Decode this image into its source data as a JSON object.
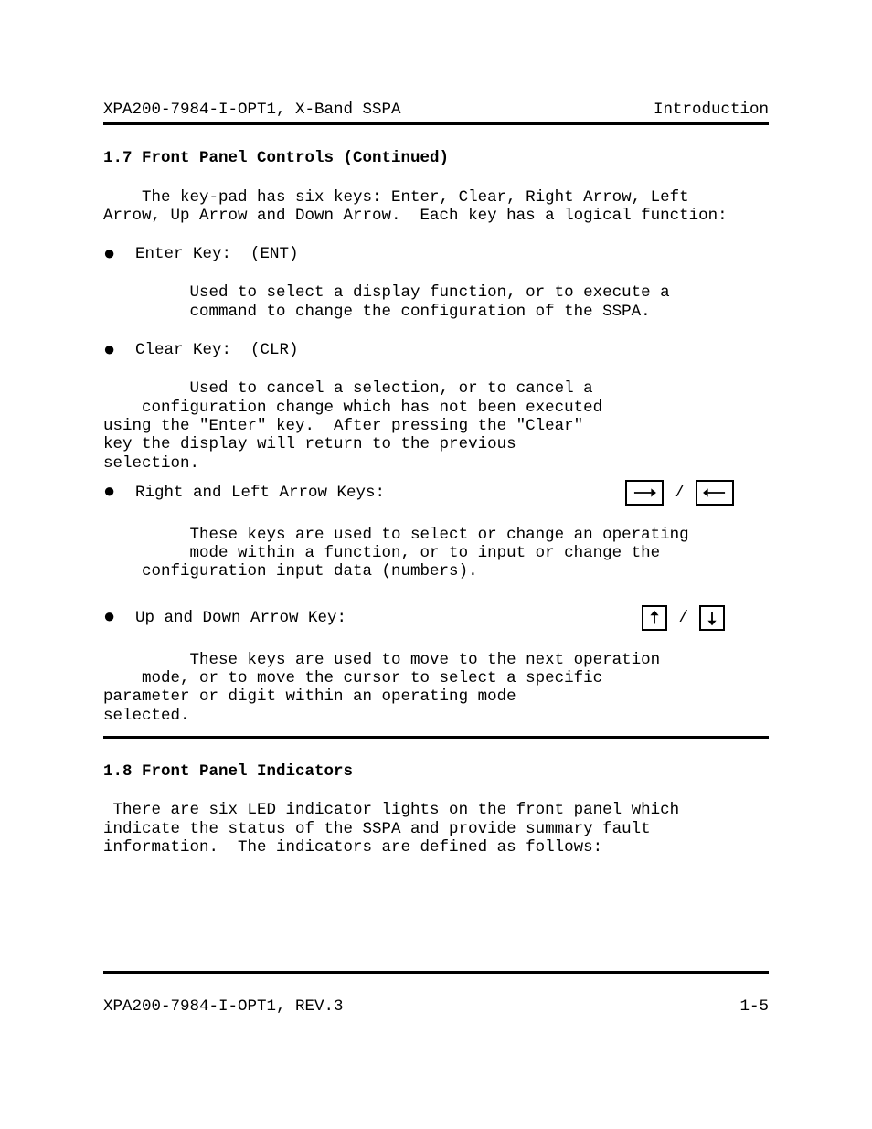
{
  "header_left": "XPA200-7984-I-OPT1, X-Band SSPA",
  "header_right": "Introduction",
  "section1": {
    "heading": "1.7 Front Panel Controls (Continued)",
    "intro_l1": "    The key-pad has six keys: Enter, Clear, Right Arrow, Left",
    "intro_l2": "Arrow, Up Arrow and Down Arrow.  Each key has a logical function:",
    "b1_label": "  Enter Key:  (ENT)",
    "b1_desc_l1": "         Used to select a display function, or to execute a",
    "b1_desc_l2": "         command to change the configuration of the SSPA.",
    "b2_label": "  Clear Key:  (CLR)",
    "b2_desc_l1": "         Used to cancel a selection, or to cancel a",
    "b2_desc_l2": "    configuration change which has not been executed",
    "b2_desc_l3": "using the \"Enter\" key.  After pressing the \"Clear\"",
    "b2_desc_l4": "key the display will return to the previous",
    "b2_desc_l5": "selection.",
    "b3_label": "  Right and Left Arrow Keys:",
    "b3_desc_l1": "         These keys are used to select or change an operating",
    "b3_desc_l2": "         mode within a function, or to input or change the",
    "b3_desc_l3": "    configuration input data (numbers).",
    "b4_label": "  Up and Down Arrow Key:",
    "b4_desc_l1": "         These keys are used to move to the next operation",
    "b4_desc_l2": "    mode, or to move the cursor to select a specific",
    "b4_desc_l3": "parameter or digit within an operating mode",
    "b4_desc_l4": "selected.",
    "slash": "/"
  },
  "section2": {
    "heading": "1.8  Front Panel Indicators",
    "p_l1": " There are six LED indicator lights on the front panel which",
    "p_l2": "indicate the status of the SSPA and provide summary fault",
    "p_l3": "information.  The indicators are defined as follows:"
  },
  "footer_left": "XPA200-7984-I-OPT1, REV.3",
  "footer_right": "1-5"
}
